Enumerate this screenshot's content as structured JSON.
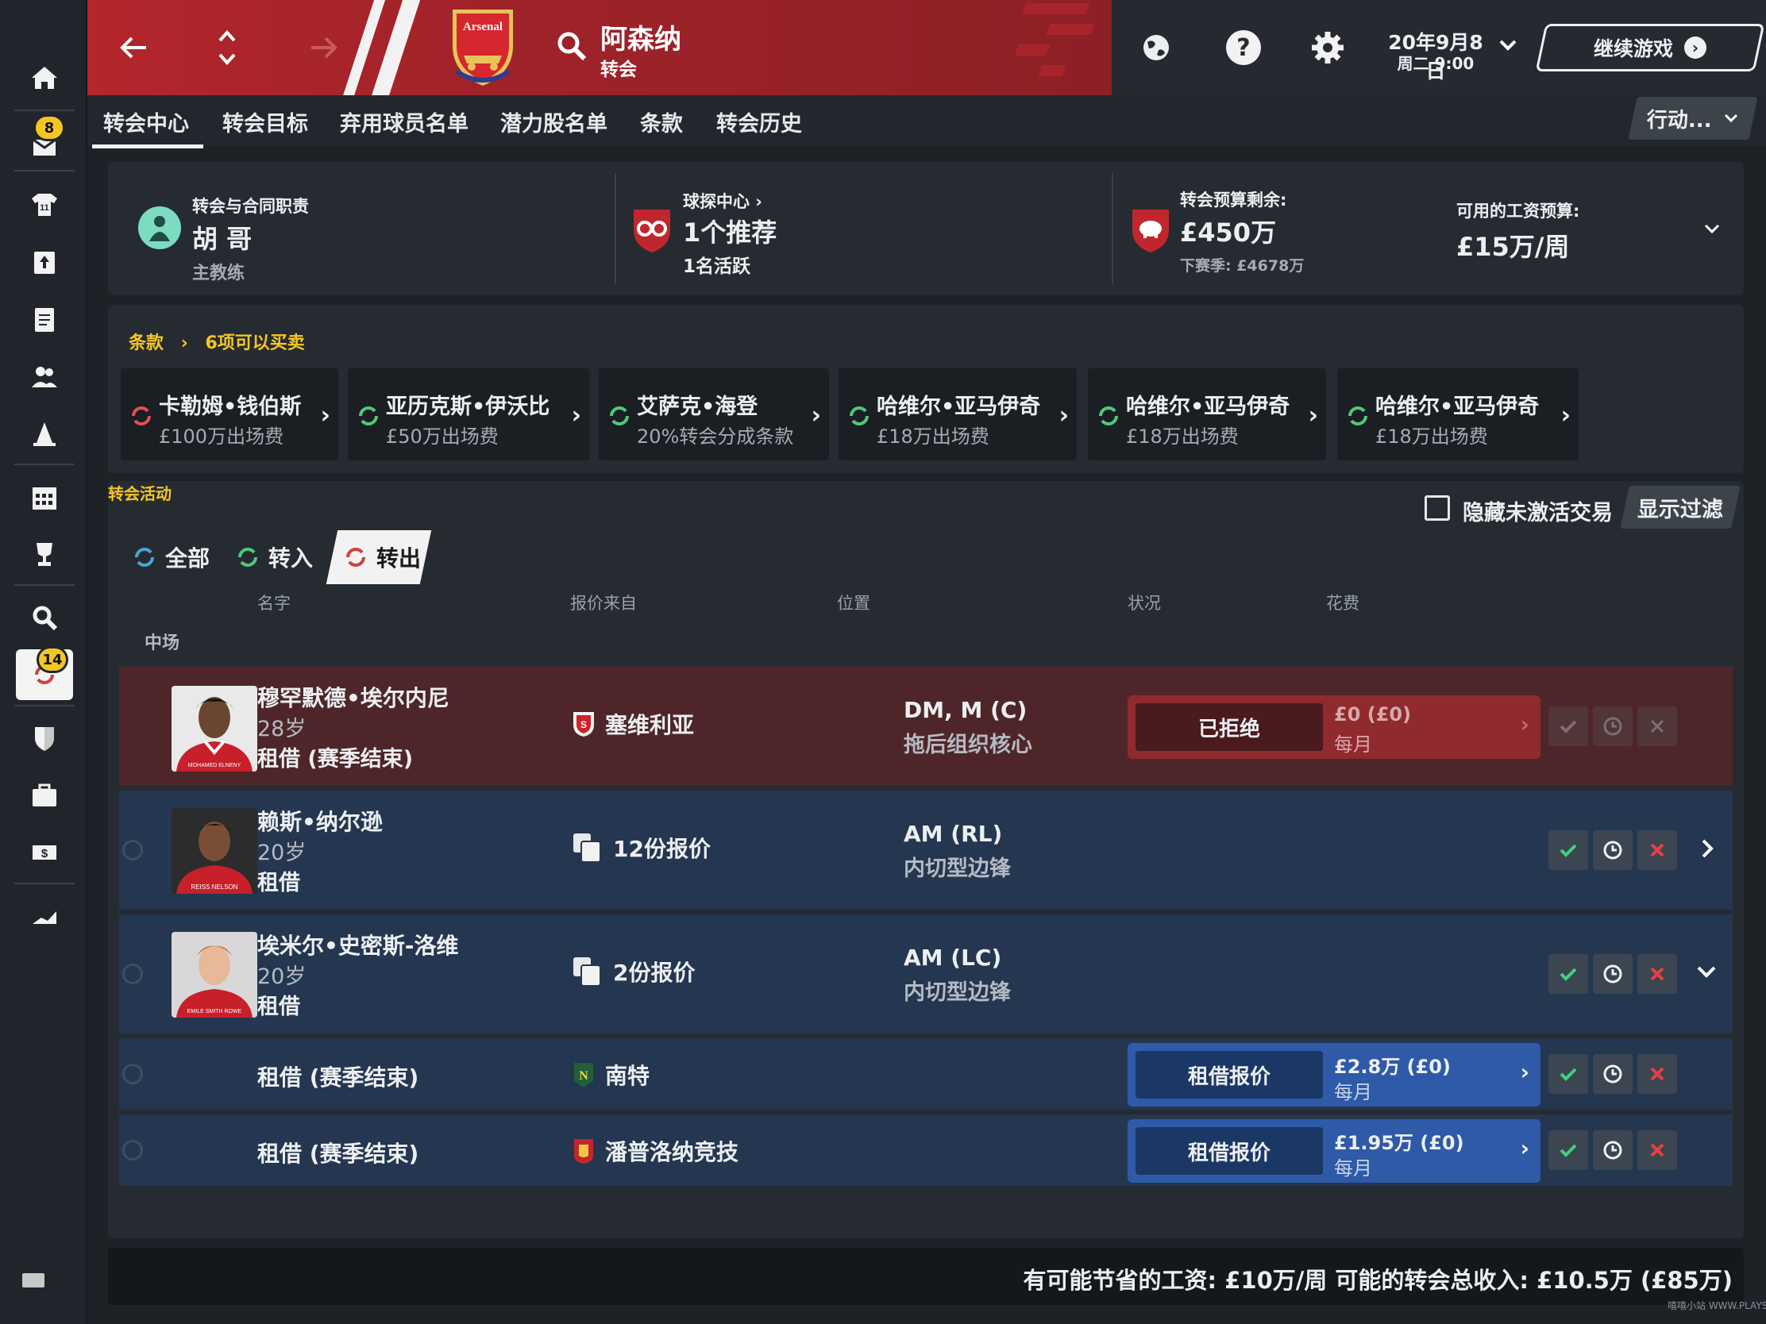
{
  "header": {
    "club_name": "阿森纳",
    "section": "转会",
    "crest_text": "Arsenal",
    "date": "20年9月8日",
    "weekday_time": "周二 9:00",
    "continue_label": "继续游戏"
  },
  "tabs": [
    "转会中心",
    "转会目标",
    "弃用球员名单",
    "潜力股名单",
    "条款",
    "转会历史"
  ],
  "action_label": "行动...",
  "summary": {
    "manager_title": "转会与合同职责",
    "manager_name": "胡 哥",
    "manager_role": "主教练",
    "scout_title": "球探中心",
    "scout_value": "1个推荐",
    "scout_sub": "1名活跃",
    "budget_title": "转会预算剩余:",
    "budget_value": "£450万",
    "budget_next": "下赛季: £4678万",
    "wage_title": "可用的工资预算:",
    "wage_value": "£15万/周"
  },
  "clauses": {
    "breadcrumb": "条款",
    "count_label": "6项可以买卖",
    "cards": [
      {
        "name": "卡勒姆•钱伯斯",
        "sub": "£100万出场费",
        "color": "#e05050"
      },
      {
        "name": "亚历克斯•伊沃比",
        "sub": "£50万出场费",
        "color": "#50c878"
      },
      {
        "name": "艾萨克•海登",
        "sub": "20%转会分成条款",
        "color": "#50c878"
      },
      {
        "name": "哈维尔•亚马伊奇",
        "sub": "£18万出场费",
        "color": "#50c878"
      },
      {
        "name": "哈维尔•亚马伊奇",
        "sub": "£18万出场费",
        "color": "#50c878"
      },
      {
        "name": "哈维尔•亚马伊奇",
        "sub": "£18万出场费",
        "color": "#50c878"
      }
    ]
  },
  "activity": {
    "title": "转会活动",
    "hide_inactive": "隐藏未激活交易",
    "show_filter": "显示过滤",
    "filters": [
      "全部",
      "转入",
      "转出"
    ],
    "columns": {
      "name": "名字",
      "from": "报价来自",
      "position": "位置",
      "status": "状况",
      "cost": "花费"
    },
    "group": "中场"
  },
  "rows": [
    {
      "name": "穆罕默德•埃尔内尼",
      "age": "28岁",
      "deal": "租借 (赛季结束)",
      "club": "塞维利亚",
      "pos": "DM, M (C)",
      "role": "拖后组织核心",
      "status": "已拒绝",
      "value": "£0 (£0)",
      "period": "每月",
      "jersey": "MOHAMED ELNENY"
    },
    {
      "name": "赖斯•纳尔逊",
      "age": "20岁",
      "deal": "租借",
      "offers": "12份报价",
      "pos": "AM (RL)",
      "role": "内切型边锋",
      "jersey": "REISS NELSON"
    },
    {
      "name": "埃米尔•史密斯-洛维",
      "age": "20岁",
      "deal": "租借",
      "offers": "2份报价",
      "pos": "AM (LC)",
      "role": "内切型边锋",
      "jersey": "EMILE SMITH ROWE"
    },
    {
      "deal": "租借 (赛季结束)",
      "club": "南特",
      "status": "租借报价",
      "value": "£2.8万 (£0)",
      "period": "每月"
    },
    {
      "deal": "租借 (赛季结束)",
      "club": "潘普洛纳竞技",
      "status": "租借报价",
      "value": "£1.95万 (£0)",
      "period": "每月"
    }
  ],
  "sidebar": {
    "inbox_badge": "8",
    "transfer_badge": "14"
  },
  "footer": {
    "text": "有可能节省的工资: £10万/周 可能的转会总收入: £10.5万 (£85万)"
  },
  "watermark": "嘻嘻小站 WWW.PLAYSM.CC"
}
